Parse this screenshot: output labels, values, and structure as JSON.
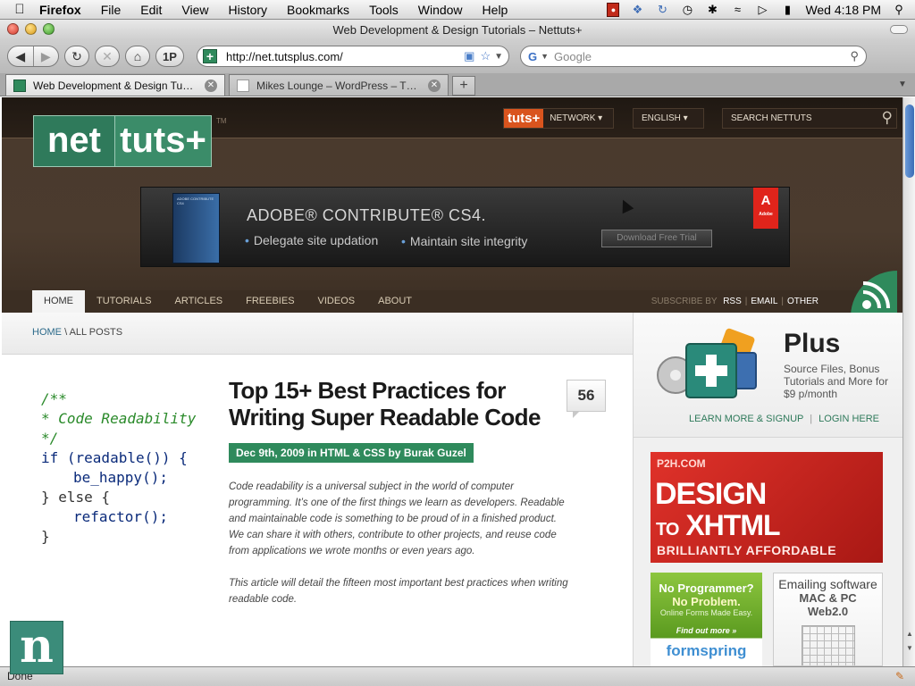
{
  "menubar": {
    "apple": "",
    "items": [
      "Firefox",
      "File",
      "Edit",
      "View",
      "History",
      "Bookmarks",
      "Tools",
      "Window",
      "Help"
    ],
    "clock": "Wed 4:18 PM",
    "status_icons": [
      "record-icon",
      "dropbox-icon",
      "sync-icon",
      "time-machine-icon",
      "bluetooth-icon",
      "wifi-icon",
      "volume-icon",
      "battery-icon",
      "spotlight-icon"
    ]
  },
  "window": {
    "title": "Web Development & Design Tutorials – Nettuts+"
  },
  "toolbar": {
    "back": "◀",
    "forward": "▶",
    "reload": "↻",
    "stop": "✕",
    "home": "⌂",
    "onepassword": "1P",
    "url": "http://net.tutsplus.com/",
    "search_placeholder": "Google"
  },
  "tabs": [
    {
      "label": "Web Development & Design Tu…",
      "active": true
    },
    {
      "label": "Mikes Lounge – WordPress – T…",
      "active": false
    }
  ],
  "newtab": "+",
  "site": {
    "logo_left": "net",
    "logo_right": "tuts+",
    "logo_tm": "TM",
    "tuts_badge": "tuts+",
    "network": "NETWORK ▾",
    "language": "ENGLISH ▾",
    "search_placeholder": "SEARCH NETTUTS"
  },
  "ad": {
    "box_text": "ADOBE CONTRIBUTE CS4",
    "headline": "ADOBE® CONTRIBUTE® CS4.",
    "point1": "Delegate site updation",
    "point2": "Maintain site integrity",
    "button": "Download Free Trial",
    "brand_letter": "A",
    "brand_word": "Adobe"
  },
  "nav": {
    "items": [
      "HOME",
      "TUTORIALS",
      "ARTICLES",
      "FREEBIES",
      "VIDEOS",
      "ABOUT"
    ],
    "subscribe_label": "SUBSCRIBE BY",
    "subscribe_links": [
      "RSS",
      "EMAIL",
      "OTHER"
    ]
  },
  "breadcrumb": {
    "home": "HOME",
    "sep": "\\",
    "current": "ALL POSTS"
  },
  "code_image": {
    "lines": [
      "/**",
      "* Code Readability",
      "*/",
      "if (readable()) {",
      "be_happy();",
      "} else {",
      "refactor();",
      "}"
    ]
  },
  "article": {
    "title": "Top 15+ Best Practices for Writing Super Readable Code",
    "meta": "Dec 9th, 2009 in HTML & CSS by Burak Guzel",
    "comments": "56",
    "para1": "Code readability is a universal subject in the world of computer programming. It’s one of the first things we learn as developers. Readable and maintainable code is something to be proud of in a finished product. We can share it with others, contribute to other projects, and reuse code from applications we wrote months or even years ago.",
    "para2": "This article will detail the fifteen most important best practices when writing readable code."
  },
  "sidebar": {
    "plus_title": "Plus",
    "plus_desc": "Source Files, Bonus Tutorials and More for $9 p/month",
    "learn_more": "LEARN MORE & SIGNUP",
    "login": "LOGIN HERE",
    "link_sep": "|",
    "p2h": {
      "domain": "P2H.COM",
      "line1": "DESIGN",
      "line2a": "TO",
      "line2b": "XHTML",
      "tagline": "BRILLIANTLY AFFORDABLE"
    },
    "formspring": {
      "l1": "No Programmer?",
      "l2": "No Problem.",
      "l3": "Online Forms Made Easy.",
      "l4": "Find out more »",
      "l5": "formspring"
    },
    "emailing": {
      "l1": "Emailing software",
      "l2": "MAC & PC",
      "l3": "Web2.0"
    }
  },
  "status": {
    "text": "Done"
  },
  "overlay": {
    "badge": "n"
  },
  "colors": {
    "brand_green": "#2f8a5c",
    "tuts_orange": "#d9541e",
    "header_brown": "#3b2e23",
    "p2h_red": "#c8241c",
    "formspring_green": "#8dc63f"
  }
}
